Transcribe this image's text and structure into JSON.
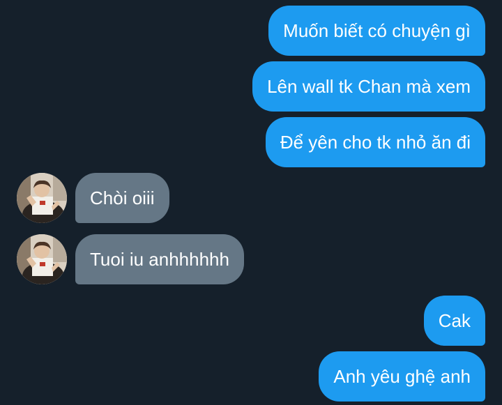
{
  "conversation": {
    "messages": [
      {
        "direction": "outgoing",
        "text": "Muốn biết có chuyện gì"
      },
      {
        "direction": "outgoing",
        "text": "Lên wall tk Chan mà xem"
      },
      {
        "direction": "outgoing",
        "text": "Để yên cho tk nhỏ ăn đi"
      },
      {
        "direction": "incoming",
        "text": "Chòi oiii",
        "avatar_icon": "user-avatar-photo"
      },
      {
        "direction": "incoming",
        "text": "Tuoi iu anhhhhhh",
        "avatar_icon": "user-avatar-photo"
      },
      {
        "direction": "outgoing",
        "text": "Cak"
      },
      {
        "direction": "outgoing",
        "text": "Anh yêu ghệ anh"
      }
    ]
  },
  "theme": {
    "background": "#15202b",
    "outgoing_bubble": "#1d9bf0",
    "incoming_bubble": "#657786",
    "text": "#ffffff"
  }
}
